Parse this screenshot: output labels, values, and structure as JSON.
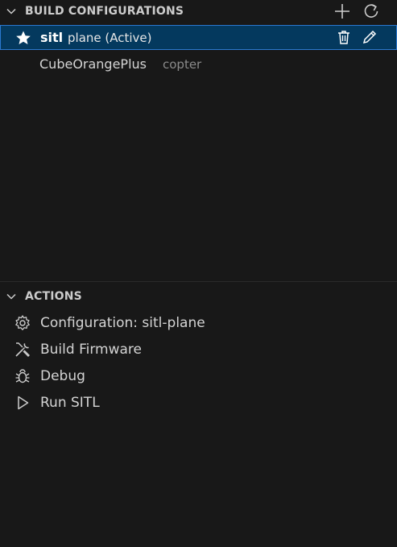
{
  "build_configurations": {
    "title": "BUILD CONFIGURATIONS",
    "items": [
      {
        "name": "sitl",
        "description": "plane (Active)",
        "active": true
      },
      {
        "name": "CubeOrangePlus",
        "description": "copter",
        "active": false
      }
    ]
  },
  "actions": {
    "title": "ACTIONS",
    "items": [
      {
        "label": "Configuration: sitl-plane",
        "icon": "gear-icon"
      },
      {
        "label": "Build Firmware",
        "icon": "tools-icon"
      },
      {
        "label": "Debug",
        "icon": "bug-icon"
      },
      {
        "label": "Run SITL",
        "icon": "play-icon"
      }
    ]
  },
  "colors": {
    "background": "#181818",
    "selected_row": "#04395e",
    "selected_border": "#2b79d0"
  }
}
